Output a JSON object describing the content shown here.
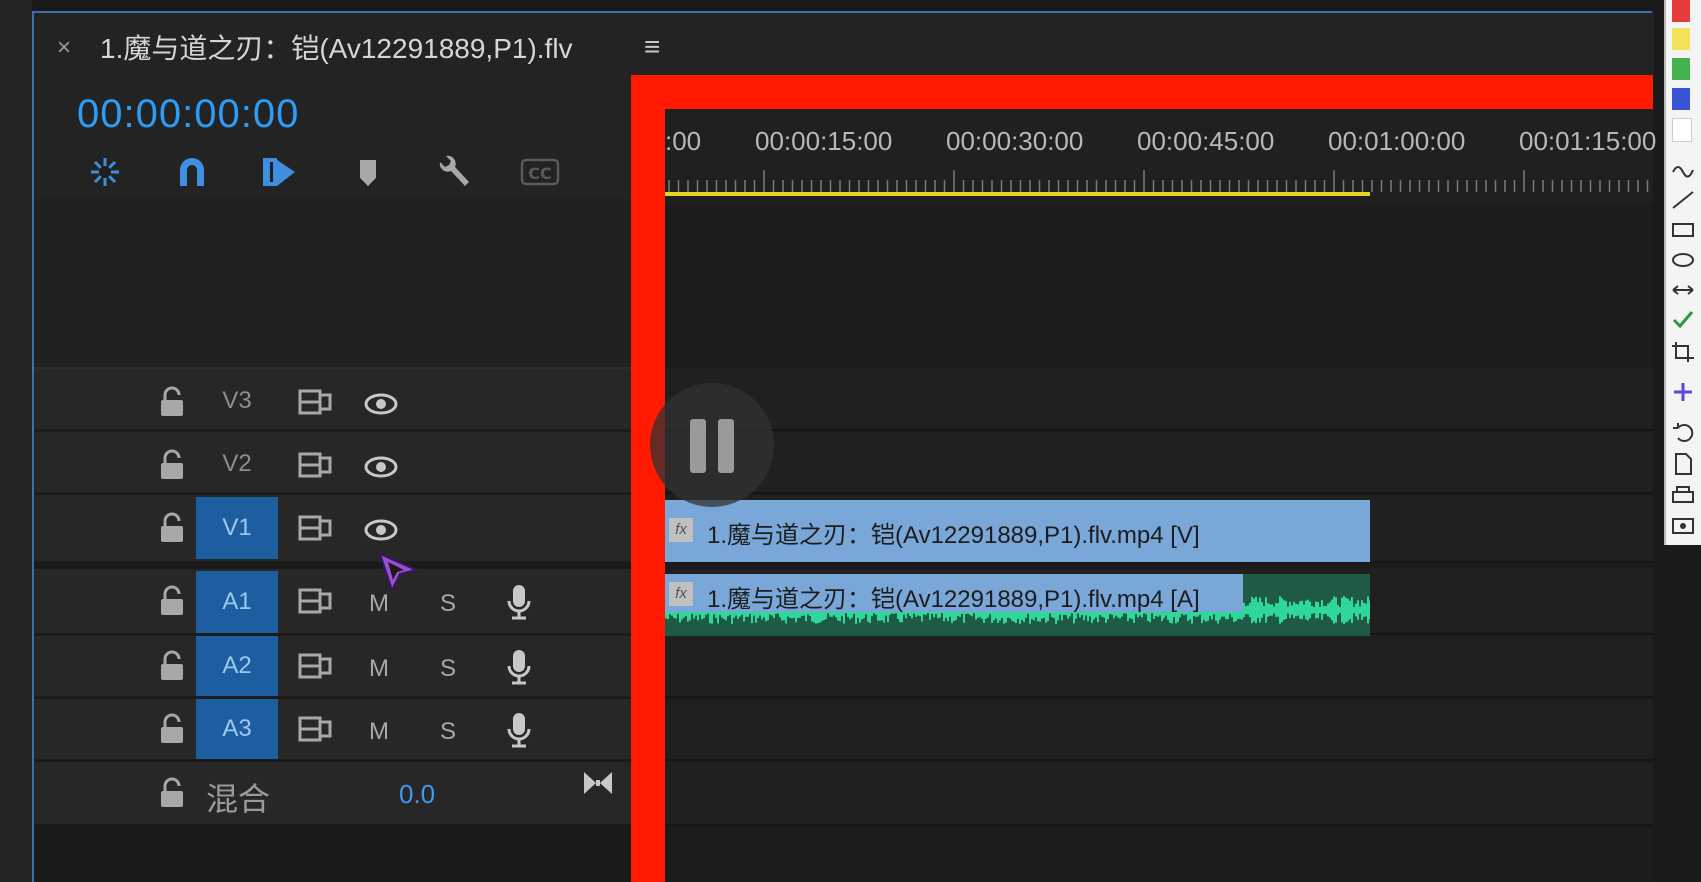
{
  "tab": {
    "close_glyph": "×",
    "title": "1.魔与道之刃：铠(Av12291889,P1).flv",
    "menu_glyph": "≡"
  },
  "header": {
    "timecode": "00:00:00:00",
    "cc_label": "CC"
  },
  "ruler": {
    "labels": [
      ":00",
      "00:00:15:00",
      "00:00:30:00",
      "00:00:45:00",
      "00:01:00:00",
      "00:01:15:00"
    ],
    "playbar_color": "#e8d523"
  },
  "tracks": {
    "video": [
      {
        "name": "V3",
        "active": false
      },
      {
        "name": "V2",
        "active": false
      },
      {
        "name": "V1",
        "active": true
      }
    ],
    "audio": [
      {
        "name": "A1",
        "mute": "M",
        "solo": "S",
        "active": true
      },
      {
        "name": "A2",
        "mute": "M",
        "solo": "S",
        "active": true
      },
      {
        "name": "A3",
        "mute": "M",
        "solo": "S",
        "active": true
      }
    ],
    "mix": {
      "label": "混合",
      "value": "0.0"
    }
  },
  "clips": {
    "video": {
      "fx": "fx",
      "label": "1.魔与道之刃：铠(Av12291889,P1).flv.mp4 [V]"
    },
    "audio": {
      "fx": "fx",
      "label": "1.魔与道之刃：铠(Av12291889,P1).flv.mp4 [A]"
    }
  },
  "colors": {
    "accent_blue": "#2e9bf5",
    "track_active": "#1d5ea1",
    "highlight_red": "#ff1a00",
    "video_clip": "#78a7d8",
    "audio_wave": "#2fd79a"
  },
  "icons": {
    "toolbar": [
      "snap-icon",
      "magnet-icon",
      "linked-selection-icon",
      "marker-icon",
      "wrench-icon",
      "cc-icon"
    ],
    "track": [
      "lock-icon",
      "sync-lock-icon",
      "eye-icon",
      "mic-icon"
    ],
    "playback": "pause-icon"
  }
}
